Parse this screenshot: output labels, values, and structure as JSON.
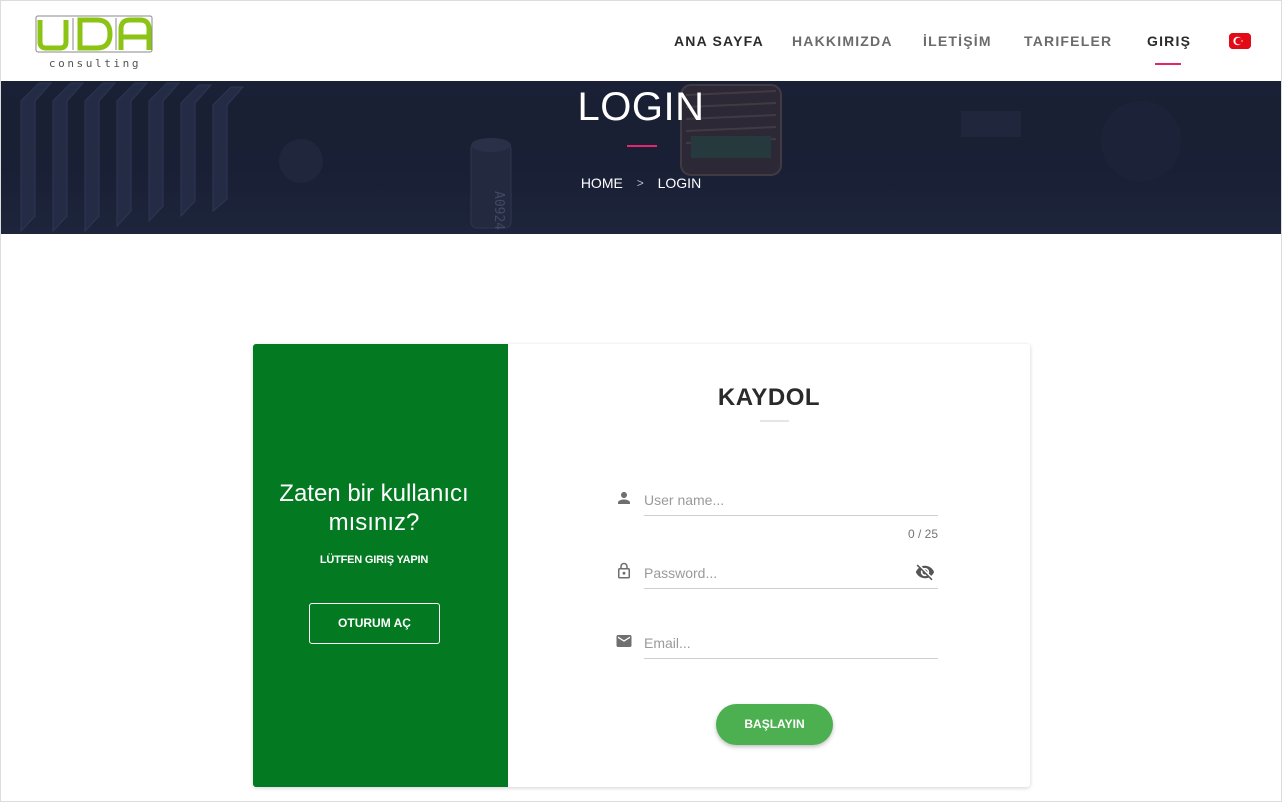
{
  "brand": {
    "logo_letters": "UDA",
    "logo_tagline": "consulting",
    "logo_color": "#8bc414"
  },
  "nav": {
    "items": [
      {
        "label": "ANA SAYFA"
      },
      {
        "label": "HAKKIMIZDA"
      },
      {
        "label": "İLETİŞİM"
      },
      {
        "label": "TARIFELER"
      },
      {
        "label": "GIRIŞ"
      }
    ],
    "active": "GIRIŞ",
    "accent_color": "#e4266f",
    "language_flag": "turkey-flag-icon"
  },
  "hero": {
    "title": "LOGIN",
    "breadcrumb": {
      "home": "HOME",
      "separator": ">",
      "current": "LOGIN"
    }
  },
  "left_panel": {
    "heading": "Zaten bir kullanıcı mısınız?",
    "subtext": "LÜTFEN GIRIŞ YAPIN",
    "button_label": "OTURUM AÇ",
    "background_color": "#037a21"
  },
  "form": {
    "title": "KAYDOL",
    "username": {
      "placeholder": "User name...",
      "value": "",
      "counter": "0 / 25",
      "icon": "person-icon"
    },
    "password": {
      "placeholder": "Password...",
      "value": "",
      "icon": "lock-icon",
      "toggle_icon": "eye-off-icon"
    },
    "email": {
      "placeholder": "Email...",
      "value": "",
      "icon": "mail-icon"
    },
    "submit_label": "BAŞLAYIN",
    "submit_color": "#4caf50"
  }
}
